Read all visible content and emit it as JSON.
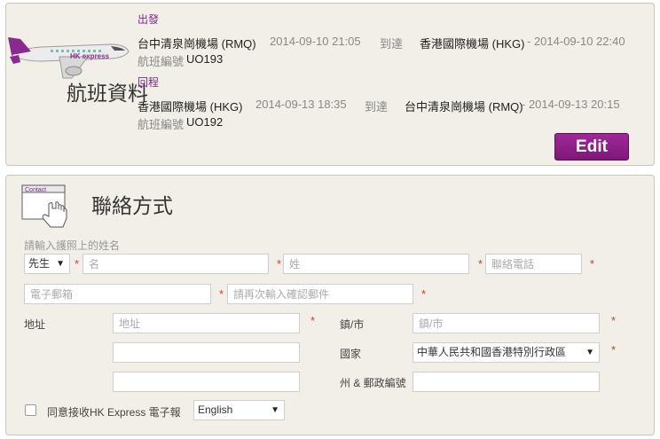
{
  "flight": {
    "section_title": "航班資料",
    "outbound": {
      "label": "出發",
      "from": "台中清泉崗機場 (RMQ)",
      "depart_time": "2014-09-10 21:05",
      "arrive_label": "到達",
      "to": "香港國際機場 (HKG)",
      "arrive_time": "- 2014-09-10 22:40",
      "flight_no_label": "航班編號",
      "flight_no": "UO193"
    },
    "return": {
      "label": "回程",
      "from": "香港國際機場 (HKG)",
      "depart_time": "2014-09-13 18:35",
      "arrive_label": "到達",
      "to": "台中清泉崗機場 (RMQ)",
      "arrive_time": "- 2014-09-13 20:15",
      "flight_no_label": "航班編號",
      "flight_no": "UO192"
    },
    "edit_label": "Edit",
    "plane_logo": "HK express"
  },
  "contact": {
    "icon_label": "Contact",
    "title": "聯絡方式",
    "name_hint": "請輸入護照上的姓名",
    "title_select": "先生",
    "first_name_placeholder": "名",
    "last_name_placeholder": "姓",
    "phone_placeholder": "聯絡電話",
    "email_placeholder": "電子郵箱",
    "email_confirm_placeholder": "請再次輸入確認郵件",
    "address_label": "地址",
    "address_placeholder": "地址",
    "city_label": "鎮/市",
    "city_placeholder": "鎮/市",
    "country_label": "國家",
    "country_value": "中華人民共和國香港特別行政區",
    "state_zip_label": "州 & 郵政編號",
    "newsletter_label": "同意接收HK Express 電子報",
    "language_value": "English",
    "required_mark": "*"
  },
  "colors": {
    "brand_purple": "#7e1877",
    "required_red": "#d23a3a",
    "panel_bg": "#f1efe7"
  }
}
